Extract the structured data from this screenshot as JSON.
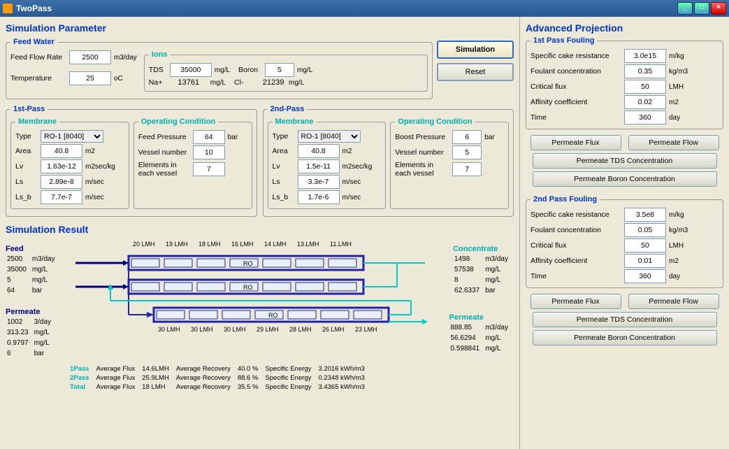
{
  "title": "TwoPass",
  "sections": {
    "simParam": "Simulation Parameter",
    "feedWater": "Feed Water",
    "ions": "Ions",
    "firstPass": "1st-Pass",
    "secondPass": "2nd-Pass",
    "membrane": "Membrane",
    "opCond": "Operating Condition",
    "simResult": "Simulation Result",
    "advProj": "Advanced Projection",
    "foul1": "1st Pass Fouling",
    "foul2": "2nd Pass Fouling"
  },
  "feed": {
    "flowLabel": "Feed Flow Rate",
    "flow": "2500",
    "flowU": "m3/day",
    "tempLabel": "Temperature",
    "temp": "25",
    "tempU": "oC"
  },
  "ions": {
    "tdsL": "TDS",
    "tds": "35000",
    "boronL": "Boron",
    "boron": "5",
    "naL": "Na+",
    "na": "13761",
    "clL": "Cl-",
    "cl": "21239",
    "u": "mg/L"
  },
  "buttons": {
    "sim": "Simulation",
    "reset": "Reset",
    "pflux": "Permeate Flux",
    "pflow": "Permeate Flow",
    "ptds": "Permeate TDS Concentration",
    "pboron": "Permeate Boron Concentration"
  },
  "p1": {
    "typeL": "Type",
    "type": "RO-1 [8040]",
    "areaL": "Area",
    "area": "40.8",
    "areaU": "m2",
    "lvL": "Lv",
    "lv": "1.63e-12",
    "lvU": "m2sec/kg",
    "lsL": "Ls",
    "ls": "2.89e-8",
    "lsU": "m/sec",
    "lsbL": "Ls_b",
    "lsb": "7.7e-7",
    "lsbU": "m/sec",
    "fpL": "Feed Pressure",
    "fp": "64",
    "fpU": "bar",
    "vnL": "Vessel number",
    "vn": "10",
    "evL": "Elements in each vessel",
    "ev": "7"
  },
  "p2": {
    "typeL": "Type",
    "type": "RO-1 [8040]",
    "areaL": "Area",
    "area": "40.8",
    "areaU": "m2",
    "lvL": "Lv",
    "lv": "1.5e-11",
    "lvU": "m2sec/kg",
    "lsL": "Ls",
    "ls": "3.3e-7",
    "lsU": "m/sec",
    "lsbL": "Ls_b",
    "lsb": "1.7e-6",
    "lsbU": "m/sec",
    "bpL": "Boost Pressure",
    "bp": "6",
    "bpU": "bar",
    "vnL": "Vessel number",
    "vn": "5",
    "evL": "Elements in each vessel",
    "ev": "7"
  },
  "foul": {
    "scrL": "Specific cake resistance",
    "scrU": "m/kg",
    "fcL": "Foulant concentration",
    "fcU": "kg/m3",
    "cfL": "Critical flux",
    "cfU": "LMH",
    "acL": "Affinity coefficient",
    "acU": "m2",
    "tL": "Time",
    "tU": "day"
  },
  "f1": {
    "scr": "3.0e15",
    "fc": "0.35",
    "cf": "50",
    "ac": "0.02",
    "t": "360"
  },
  "f2": {
    "scr": "3.5e8",
    "fc": "0.05",
    "cf": "50",
    "ac": "0.01",
    "t": "360"
  },
  "result": {
    "feedH": "Feed",
    "concH": "Concentrate",
    "permH": "Permeate",
    "perm2H": "Permeate",
    "lmh1": [
      "20 LMH",
      "19 LMH",
      "18 LMH",
      "16 LMH",
      "14 LMH",
      "13.LMH",
      "11.LMH"
    ],
    "lmh2": [
      "30 LMH",
      "30 LMH",
      "30 LMH",
      "29 LMH",
      "28 LMH",
      "26 LMH",
      "23 LMH"
    ],
    "feedVals": [
      [
        "2500",
        "m3/day"
      ],
      [
        "35000",
        "mg/L"
      ],
      [
        "5",
        "mg/L"
      ],
      [
        "64",
        "bar"
      ]
    ],
    "concVals": [
      [
        "1498",
        "m3/day"
      ],
      [
        "57538",
        "mg/L"
      ],
      [
        "8",
        "mg/L"
      ],
      [
        "62.6337",
        "bar"
      ]
    ],
    "permVals": [
      [
        "1002",
        "3/day"
      ],
      [
        "313.23",
        "mg/L"
      ],
      [
        "0.9797",
        "mg/L"
      ],
      [
        "6",
        "bar"
      ]
    ],
    "perm2Vals": [
      [
        "888.85",
        "m3/day"
      ],
      [
        "56.6294",
        "mg/L"
      ],
      [
        "0.598841",
        "mg/L"
      ]
    ],
    "sum": {
      "p1L": "1Pass",
      "p2L": "2Pass",
      "totL": "Total",
      "rows": [
        [
          "Average Flux",
          "14.6LMH",
          "Average Recovery",
          "40.0 %",
          "Specific Energy",
          "3.2016 kWh/m3"
        ],
        [
          "Average Flux",
          "25.9LMH",
          "Average Recovery",
          "88.6 %",
          "Specific Energy",
          "0.2348 kWh/m3"
        ],
        [
          "Average Flux",
          "18   LMH",
          "Average Recovery",
          "35.5 %",
          "Specific Energy",
          "3.4365 kWh/m3"
        ]
      ]
    }
  },
  "chart_data": {
    "type": "diagram",
    "note": "Two-pass RO vessel arrangement with LMH flux labels — values captured in result.lmh1/lmh2"
  }
}
